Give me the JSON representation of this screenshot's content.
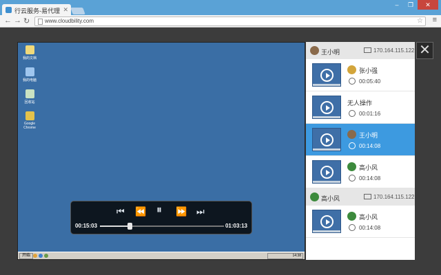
{
  "browser": {
    "tab_title": "行云服务-易代理",
    "url": "www.cloudbility.com",
    "close_glyph": "✕",
    "minimize_glyph": "–",
    "maximize_glyph": "❐"
  },
  "desktop": {
    "icons": [
      {
        "label": "我的文档",
        "color": "#f0d97a"
      },
      {
        "label": "我的电脑",
        "color": "#9fc6ee"
      },
      {
        "label": "回收站",
        "color": "#c9e2c2"
      },
      {
        "label": "Google Chrome",
        "color": "#e4c24b"
      }
    ],
    "start_label": "开始",
    "tray_time": "14:38"
  },
  "player": {
    "current_time": "00:15:03",
    "total_time": "01:03:13",
    "progress": 0.24
  },
  "sidebar": {
    "groups": [
      {
        "name": "王小明",
        "ip": "170.164.115.122",
        "avatar_color": "#8a6a4a",
        "items": [
          {
            "name": "张小强",
            "duration": "00:05:40",
            "avatar_color": "#d3a53b",
            "active": false
          },
          {
            "name": "无人操作",
            "duration": "00:01:16",
            "avatar_color": "",
            "active": false
          },
          {
            "name": "王小明",
            "duration": "00:14:08",
            "avatar_color": "#8a6a4a",
            "active": true
          },
          {
            "name": "高小风",
            "duration": "00:14:08",
            "avatar_color": "#3c8a3c",
            "active": false
          }
        ]
      },
      {
        "name": "高小风",
        "ip": "170.164.115.122",
        "avatar_color": "#3c8a3c",
        "items": [
          {
            "name": "高小风",
            "duration": "00:14:08",
            "avatar_color": "#3c8a3c",
            "active": false
          }
        ]
      }
    ]
  },
  "close_button": "✕"
}
